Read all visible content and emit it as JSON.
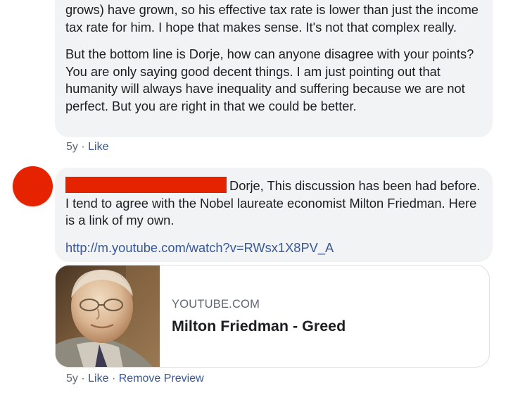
{
  "comment1": {
    "paragraph1": "grows) have grown, so his effective tax rate is lower than just the income tax rate for him. I hope that makes sense. It's not that complex really.",
    "paragraph2": "But the bottom line is Dorje, how can anyone disagree with your points? You are only saying good decent things. I am just pointing out that humanity will always have inequality and suffering because we are not perfect. But you are right in that we could be better.",
    "time": "5y",
    "separator": "·",
    "like_label": "Like"
  },
  "comment2": {
    "text": "Dorje, This discussion has been had before. I tend to agree with the Nobel laureate economist Milton Friedman. Here is a link of my own.",
    "url": "http://m.youtube.com/watch?v=RWsx1X8PV_A",
    "preview": {
      "domain": "YOUTUBE.COM",
      "title": "Milton Friedman - Greed"
    },
    "time": "5y",
    "separator": "·",
    "like_label": "Like",
    "remove_preview_label": "Remove Preview"
  },
  "colors": {
    "redaction": "#e52300",
    "link": "#385898",
    "bubble_bg": "#f2f3f5",
    "meta_text": "#606770"
  }
}
